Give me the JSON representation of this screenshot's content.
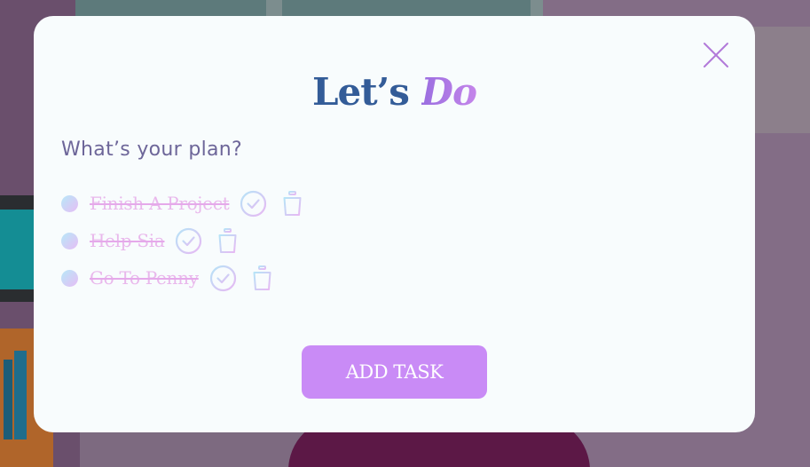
{
  "modal": {
    "title_part1": "Let’s",
    "title_part2": "Do",
    "prompt": "What’s your plan?",
    "add_button_label": "ADD TASK"
  },
  "tasks": [
    {
      "label": "Finish A Project",
      "completed": true
    },
    {
      "label": "Help Sia",
      "completed": true
    },
    {
      "label": "Go To Penny",
      "completed": true
    }
  ],
  "icons": {
    "close": "close-icon",
    "check": "check-circle-icon",
    "delete": "trash-icon"
  },
  "colors": {
    "accent": "#c98bf6",
    "title_blue": "#335c98",
    "title_purple": "#b07ce8",
    "prompt_text": "#6d6699",
    "completed_text": "#e9b8ec",
    "modal_bg": "#f8fcfd"
  }
}
